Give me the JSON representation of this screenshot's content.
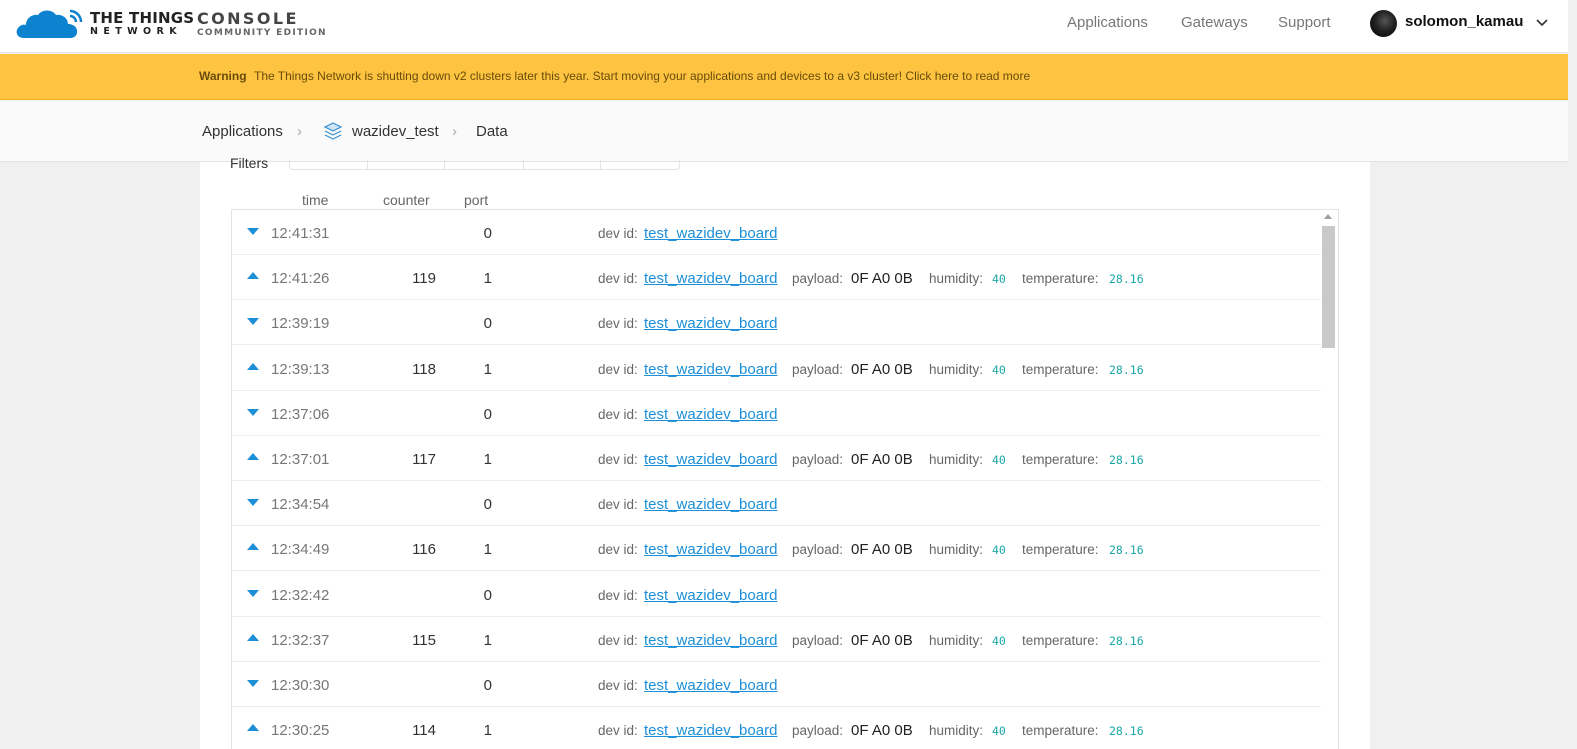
{
  "header": {
    "brand_line1": "THE THINGS",
    "brand_line2": "NETWORK",
    "console_title": "CONSOLE",
    "console_edition": "COMMUNITY EDITION",
    "nav": [
      "Applications",
      "Gateways",
      "Support"
    ],
    "username": "solomon_kamau"
  },
  "warning": {
    "label": "Warning",
    "message": "The Things Network is shutting down v2 clusters later this year. Start moving your applications and devices to a v3 cluster! Click here to read more"
  },
  "breadcrumb": {
    "applications": "Applications",
    "app_name": "wazidev_test",
    "current": "Data"
  },
  "data_view": {
    "filters_label": "Filters",
    "columns": {
      "time": "time",
      "counter": "counter",
      "port": "port"
    },
    "field_labels": {
      "dev_id": "dev id:",
      "payload": "payload:",
      "humidity": "humidity:",
      "temperature": "temperature:"
    },
    "rows": [
      {
        "direction": "down",
        "time": "12:41:31",
        "counter": "",
        "port": "0",
        "dev_id": "test_wazidev_board"
      },
      {
        "direction": "up",
        "time": "12:41:26",
        "counter": "119",
        "port": "1",
        "dev_id": "test_wazidev_board",
        "payload": "0F A0 0B",
        "humidity": "40",
        "temperature": "28.16"
      },
      {
        "direction": "down",
        "time": "12:39:19",
        "counter": "",
        "port": "0",
        "dev_id": "test_wazidev_board"
      },
      {
        "direction": "up",
        "time": "12:39:13",
        "counter": "118",
        "port": "1",
        "dev_id": "test_wazidev_board",
        "payload": "0F A0 0B",
        "humidity": "40",
        "temperature": "28.16"
      },
      {
        "direction": "down",
        "time": "12:37:06",
        "counter": "",
        "port": "0",
        "dev_id": "test_wazidev_board"
      },
      {
        "direction": "up",
        "time": "12:37:01",
        "counter": "117",
        "port": "1",
        "dev_id": "test_wazidev_board",
        "payload": "0F A0 0B",
        "humidity": "40",
        "temperature": "28.16"
      },
      {
        "direction": "down",
        "time": "12:34:54",
        "counter": "",
        "port": "0",
        "dev_id": "test_wazidev_board"
      },
      {
        "direction": "up",
        "time": "12:34:49",
        "counter": "116",
        "port": "1",
        "dev_id": "test_wazidev_board",
        "payload": "0F A0 0B",
        "humidity": "40",
        "temperature": "28.16"
      },
      {
        "direction": "down",
        "time": "12:32:42",
        "counter": "",
        "port": "0",
        "dev_id": "test_wazidev_board"
      },
      {
        "direction": "up",
        "time": "12:32:37",
        "counter": "115",
        "port": "1",
        "dev_id": "test_wazidev_board",
        "payload": "0F A0 0B",
        "humidity": "40",
        "temperature": "28.16"
      },
      {
        "direction": "down",
        "time": "12:30:30",
        "counter": "",
        "port": "0",
        "dev_id": "test_wazidev_board"
      },
      {
        "direction": "up",
        "time": "12:30:25",
        "counter": "114",
        "port": "1",
        "dev_id": "test_wazidev_board",
        "payload": "0F A0 0B",
        "humidity": "40",
        "temperature": "28.16"
      }
    ]
  },
  "colors": {
    "accent": "#1d8fd8",
    "warning_bg": "#fdc341",
    "value_teal": "#1aa7a7"
  }
}
